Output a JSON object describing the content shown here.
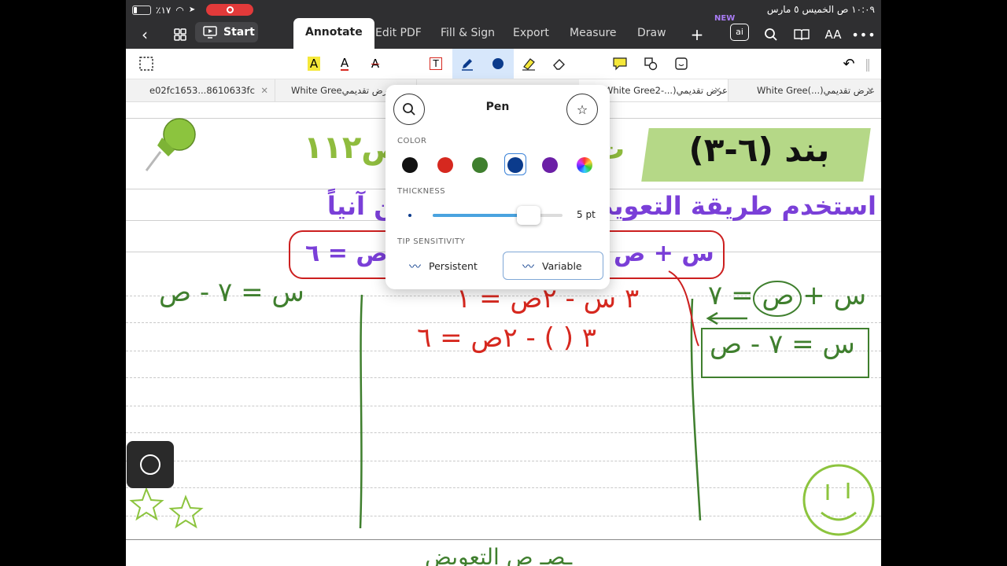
{
  "status_bar": {
    "battery": "٪١٧",
    "clock": "١٠:٠٩ ص  الخميس ٥ مارس"
  },
  "top_bar": {
    "start_label": "Start",
    "tabs": [
      {
        "label": "Annotate",
        "active": true
      },
      {
        "label": "Edit PDF"
      },
      {
        "label": "Fill & Sign"
      },
      {
        "label": "Export"
      },
      {
        "label": "Measure"
      },
      {
        "label": "Draw"
      }
    ],
    "new_badge": "NEW",
    "ai_label": "ai",
    "font_size_label": "AA"
  },
  "tools": {
    "highlight_text": "A",
    "underline_text": "A",
    "strike_text": "A",
    "textbox": "T"
  },
  "doc_tabs": [
    {
      "label": "e02fc1653...8610633fc"
    },
    {
      "label": "White Greeعرض تقديمي"
    },
    {
      "label": "White Greeعرض تقديمي(...-2"
    },
    {
      "label": "White Greeعرض تقديمي(...) 2"
    }
  ],
  "pen_popover": {
    "title": "Pen",
    "color_label": "COLOR",
    "colors": [
      "#111111",
      "#d6281f",
      "#3f7f2e",
      "#0b3b8c",
      "#6b1fa6"
    ],
    "selected_color_index": 3,
    "thickness_label": "THICKNESS",
    "thickness_value": "5 pt",
    "thickness_fraction": 0.74,
    "tip_label": "TIP SENSITIVITY",
    "tip_persistent": "Persistent",
    "tip_variable": "Variable",
    "tip_selected": "Variable"
  },
  "page": {
    "title": "بند (٦-٣)",
    "green_heading": "ص١١٢",
    "green_heading_partial": "ت",
    "purple_line": "استخدم طريقة التعويض        ة حل المعادلتين آنياً",
    "eq_right": "س + ص",
    "eq_left": "ص = ٦",
    "hw_green_left": "س = ٧ - ص",
    "hw_red_1": "٣ س - ٢ص = ١",
    "hw_red_2": "٣ (        ) - ٢ص = ٦",
    "hw_green_right_1": "س + ص = ٧",
    "hw_green_right_2": "س = ٧ - ص",
    "hw_bottom": "ـصـ ص التعويض"
  }
}
